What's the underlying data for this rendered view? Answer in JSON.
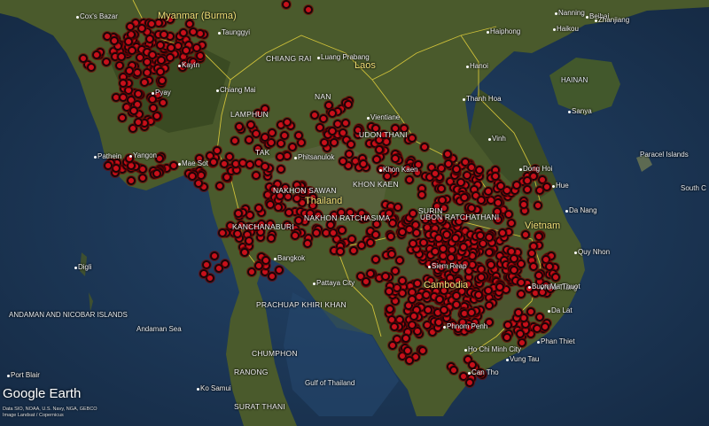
{
  "logo": "Google Earth",
  "attribution": [
    "Data SIO, NOAA, U.S. Navy, NGA, GEBCO",
    "Image Landsat / Copernicus"
  ],
  "countries": [
    {
      "name": "Myanmar (Burma)"
    },
    {
      "name": "Laos"
    },
    {
      "name": "Thailand"
    },
    {
      "name": "Cambodia"
    },
    {
      "name": "Vietnam"
    }
  ],
  "seas": [
    {
      "name": "ANDAMAN AND NICOBAR ISLANDS"
    },
    {
      "name": "Andaman Sea"
    },
    {
      "name": "Gulf of Thailand"
    },
    {
      "name": "HAINAN"
    },
    {
      "name": "Paracel Islands"
    },
    {
      "name": "South C"
    }
  ],
  "places": [
    {
      "name": "Cox's Bazar"
    },
    {
      "name": "Taunggyi"
    },
    {
      "name": "Kayin"
    },
    {
      "name": "Pyay"
    },
    {
      "name": "Yangon"
    },
    {
      "name": "Pathein"
    },
    {
      "name": "Mae Sot"
    },
    {
      "name": "CHIANG RAI"
    },
    {
      "name": "Luang Prabang"
    },
    {
      "name": "Chiang Mai"
    },
    {
      "name": "NAN"
    },
    {
      "name": "LAMPHUN"
    },
    {
      "name": "Vientiane"
    },
    {
      "name": "UDON THANI"
    },
    {
      "name": "TAK"
    },
    {
      "name": "Phitsanulok"
    },
    {
      "name": "Khon Kaen"
    },
    {
      "name": "NAKHON SAWAN"
    },
    {
      "name": "KHON KAEN"
    },
    {
      "name": "NAKHON RATCHASIMA"
    },
    {
      "name": "SURIN"
    },
    {
      "name": "UBON RATCHATHANI"
    },
    {
      "name": "KANCHANABURI"
    },
    {
      "name": "Bangkok"
    },
    {
      "name": "Pattaya City"
    },
    {
      "name": "Siem Reap"
    },
    {
      "name": "PRACHUAP KHIRI KHAN"
    },
    {
      "name": "CHUMPHON"
    },
    {
      "name": "RANONG"
    },
    {
      "name": "Ko Samui"
    },
    {
      "name": "SURAT THANI"
    },
    {
      "name": "Phnom Penh"
    },
    {
      "name": "Can Tho"
    },
    {
      "name": "Ho Chi Minh City"
    },
    {
      "name": "Vung Tau"
    },
    {
      "name": "Phan Thiet"
    },
    {
      "name": "Da Lat"
    },
    {
      "name": "Nha Trang"
    },
    {
      "name": "Buon Ma Thuot"
    },
    {
      "name": "Quy Nhon"
    },
    {
      "name": "Da Nang"
    },
    {
      "name": "Hue"
    },
    {
      "name": "Dong Hoi"
    },
    {
      "name": "Vinh"
    },
    {
      "name": "Thanh Hoa"
    },
    {
      "name": "Hanoi"
    },
    {
      "name": "Haiphong"
    },
    {
      "name": "Nanning"
    },
    {
      "name": "Beihai"
    },
    {
      "name": "Zhanjiang"
    },
    {
      "name": "Haikou"
    },
    {
      "name": "Sanya"
    },
    {
      "name": "Digli"
    },
    {
      "name": "Port Blair"
    }
  ]
}
